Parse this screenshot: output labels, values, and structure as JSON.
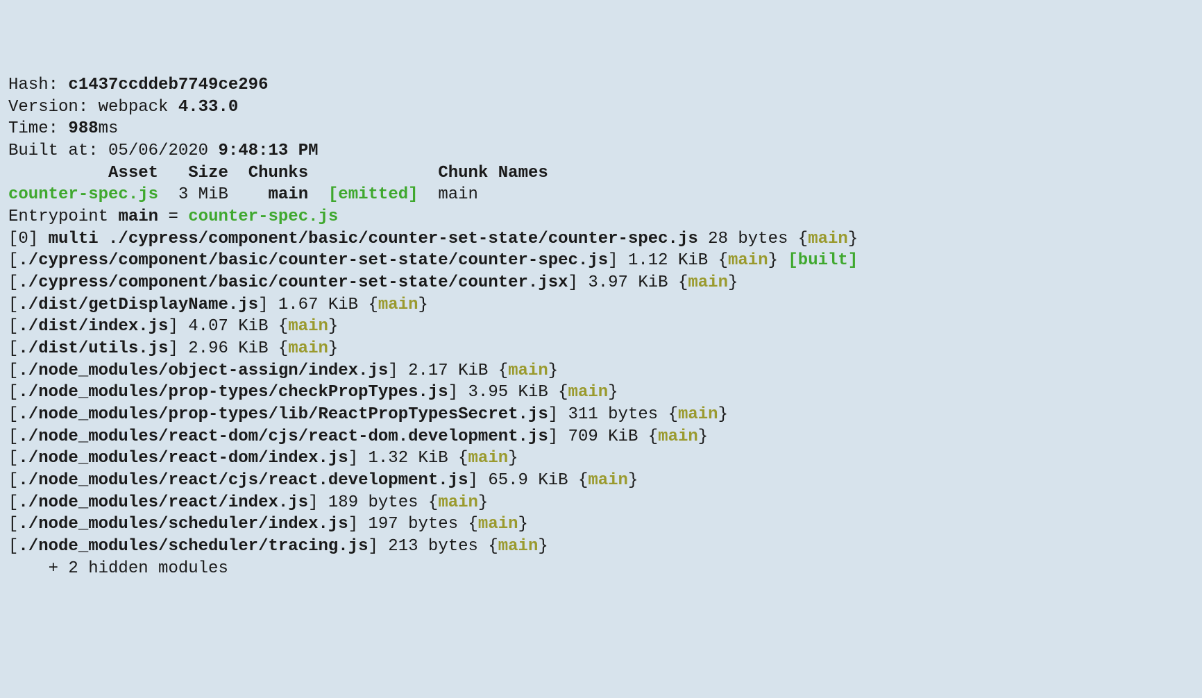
{
  "header": {
    "hash_label": "Hash: ",
    "hash": "c1437ccddeb7749ce296",
    "version_label": "Version: ",
    "version_text": "webpack ",
    "version_num": "4.33.0",
    "time_label": "Time: ",
    "time_num": "988",
    "time_unit": "ms",
    "built_label": "Built at: ",
    "built_date": "05/06/2020 ",
    "built_time": "9:48:13 PM"
  },
  "cols": {
    "asset": "Asset",
    "size": "Size",
    "chunks": "Chunks",
    "chunk_names": "Chunk Names"
  },
  "row": {
    "asset": "counter-spec.js",
    "size": "3 MiB",
    "chunk": "main",
    "emitted": "[emitted]",
    "chunk_name": "main"
  },
  "entry": {
    "label": "Entrypoint ",
    "name": "main",
    "eq": " = ",
    "file": "counter-spec.js"
  },
  "modules": [
    {
      "prefix": "[0] ",
      "path": "multi ./cypress/component/basic/counter-set-state/counter-spec.js",
      "size": " 28 bytes ",
      "chunk": "main",
      "built": ""
    },
    {
      "prefix": "[",
      "path": "./cypress/component/basic/counter-set-state/counter-spec.js",
      "suffix": "]",
      "size": " 1.12 KiB ",
      "chunk": "main",
      "built": " [built]"
    },
    {
      "prefix": "[",
      "path": "./cypress/component/basic/counter-set-state/counter.jsx",
      "suffix": "]",
      "size": " 3.97 KiB ",
      "chunk": "main",
      "built": ""
    },
    {
      "prefix": "[",
      "path": "./dist/getDisplayName.js",
      "suffix": "]",
      "size": " 1.67 KiB ",
      "chunk": "main",
      "built": ""
    },
    {
      "prefix": "[",
      "path": "./dist/index.js",
      "suffix": "]",
      "size": " 4.07 KiB ",
      "chunk": "main",
      "built": ""
    },
    {
      "prefix": "[",
      "path": "./dist/utils.js",
      "suffix": "]",
      "size": " 2.96 KiB ",
      "chunk": "main",
      "built": ""
    },
    {
      "prefix": "[",
      "path": "./node_modules/object-assign/index.js",
      "suffix": "]",
      "size": " 2.17 KiB ",
      "chunk": "main",
      "built": ""
    },
    {
      "prefix": "[",
      "path": "./node_modules/prop-types/checkPropTypes.js",
      "suffix": "]",
      "size": " 3.95 KiB ",
      "chunk": "main",
      "built": ""
    },
    {
      "prefix": "[",
      "path": "./node_modules/prop-types/lib/ReactPropTypesSecret.js",
      "suffix": "]",
      "size": " 311 bytes ",
      "chunk": "main",
      "built": ""
    },
    {
      "prefix": "[",
      "path": "./node_modules/react-dom/cjs/react-dom.development.js",
      "suffix": "]",
      "size": " 709 KiB ",
      "chunk": "main",
      "built": ""
    },
    {
      "prefix": "[",
      "path": "./node_modules/react-dom/index.js",
      "suffix": "]",
      "size": " 1.32 KiB ",
      "chunk": "main",
      "built": ""
    },
    {
      "prefix": "[",
      "path": "./node_modules/react/cjs/react.development.js",
      "suffix": "]",
      "size": " 65.9 KiB ",
      "chunk": "main",
      "built": ""
    },
    {
      "prefix": "[",
      "path": "./node_modules/react/index.js",
      "suffix": "]",
      "size": " 189 bytes ",
      "chunk": "main",
      "built": ""
    },
    {
      "prefix": "[",
      "path": "./node_modules/scheduler/index.js",
      "suffix": "]",
      "size": " 197 bytes ",
      "chunk": "main",
      "built": ""
    },
    {
      "prefix": "[",
      "path": "./node_modules/scheduler/tracing.js",
      "suffix": "]",
      "size": " 213 bytes ",
      "chunk": "main",
      "built": ""
    }
  ],
  "hidden": "    + 2 hidden modules"
}
